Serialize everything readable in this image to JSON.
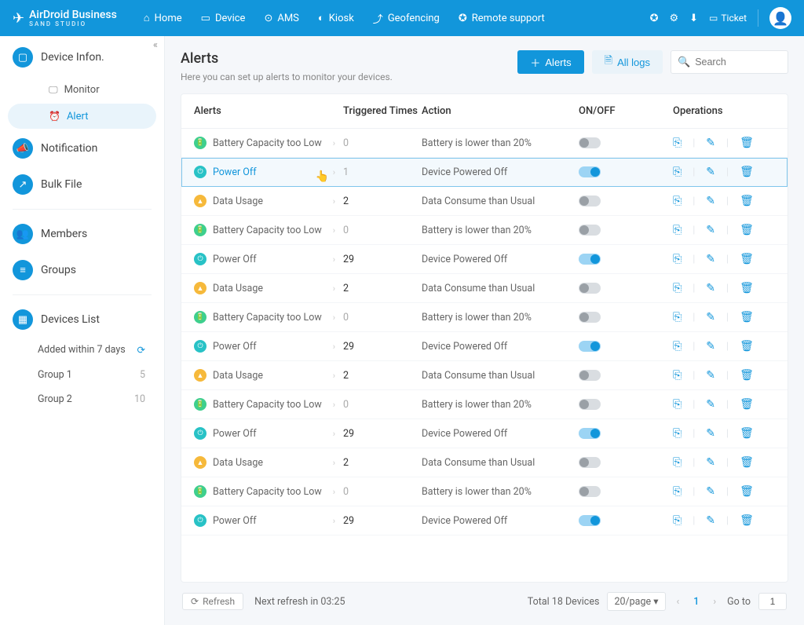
{
  "brand": {
    "name": "AirDroid Business",
    "sub": "SAND STUDIO"
  },
  "topnav": [
    {
      "label": "Home",
      "icon": "⌂"
    },
    {
      "label": "Device",
      "icon": "▭"
    },
    {
      "label": "AMS",
      "icon": "⊙"
    },
    {
      "label": "Kiosk",
      "icon": "◐"
    },
    {
      "label": "Geofencing",
      "icon": "⤴"
    },
    {
      "label": "Remote support",
      "icon": "✪"
    }
  ],
  "quick_icons": [
    "✪",
    "⚙",
    "⬇"
  ],
  "ticket_label": "Ticket",
  "sidebar": {
    "device_info": "Device Infon.",
    "monitor": "Monitor",
    "alert": "Alert",
    "notification": "Notification",
    "bulk_file": "Bulk File",
    "members": "Members",
    "groups": "Groups",
    "devices_list": "Devices List",
    "added_within": "Added within 7 days",
    "group1": {
      "label": "Group 1",
      "count": "5"
    },
    "group2": {
      "label": "Group 2",
      "count": "10"
    }
  },
  "page": {
    "title": "Alerts",
    "subtitle": "Here you can set up alerts to monitor your devices."
  },
  "actions": {
    "alerts_btn": "Alerts",
    "all_logs": "All logs",
    "search_placeholder": "Search"
  },
  "columns": {
    "alerts": "Alerts",
    "triggered": "Triggered Times",
    "action": "Action",
    "onoff": "ON/OFF",
    "operations": "Operations"
  },
  "rows": [
    {
      "badge": "green",
      "name": "Battery Capacity too Low",
      "trig": "0",
      "action": "Battery is lower than 20%",
      "on": false,
      "hl": false
    },
    {
      "badge": "teal",
      "name": "Power Off",
      "trig": "1",
      "action": "Device Powered Off",
      "on": true,
      "hl": true
    },
    {
      "badge": "orange",
      "name": "Data Usage",
      "trig": "2",
      "action": "Data Consume than Usual",
      "on": false,
      "hl": false
    },
    {
      "badge": "green",
      "name": "Battery Capacity too Low",
      "trig": "0",
      "action": "Battery is lower than 20%",
      "on": false,
      "hl": false
    },
    {
      "badge": "teal",
      "name": "Power Off",
      "trig": "29",
      "action": "Device Powered Off",
      "on": true,
      "hl": false
    },
    {
      "badge": "orange",
      "name": "Data Usage",
      "trig": "2",
      "action": "Data Consume than Usual",
      "on": false,
      "hl": false
    },
    {
      "badge": "green",
      "name": "Battery Capacity too Low",
      "trig": "0",
      "action": "Battery is lower than 20%",
      "on": false,
      "hl": false
    },
    {
      "badge": "teal",
      "name": "Power Off",
      "trig": "29",
      "action": "Device Powered Off",
      "on": true,
      "hl": false
    },
    {
      "badge": "orange",
      "name": "Data Usage",
      "trig": "2",
      "action": "Data Consume than Usual",
      "on": false,
      "hl": false
    },
    {
      "badge": "green",
      "name": "Battery Capacity too Low",
      "trig": "0",
      "action": "Battery is lower than 20%",
      "on": false,
      "hl": false
    },
    {
      "badge": "teal",
      "name": "Power Off",
      "trig": "29",
      "action": "Device Powered Off",
      "on": true,
      "hl": false
    },
    {
      "badge": "orange",
      "name": "Data Usage",
      "trig": "2",
      "action": "Data Consume than Usual",
      "on": false,
      "hl": false
    },
    {
      "badge": "green",
      "name": "Battery Capacity too Low",
      "trig": "0",
      "action": "Battery is lower than 20%",
      "on": false,
      "hl": false
    },
    {
      "badge": "teal",
      "name": "Power Off",
      "trig": "29",
      "action": "Device Powered Off",
      "on": true,
      "hl": false
    }
  ],
  "footer": {
    "refresh": "Refresh",
    "next_refresh": "Next refresh in 03:25",
    "total": "Total 18 Devices",
    "page_size": "20/page",
    "current_page": "1",
    "goto_label": "Go to",
    "goto_value": "1"
  }
}
